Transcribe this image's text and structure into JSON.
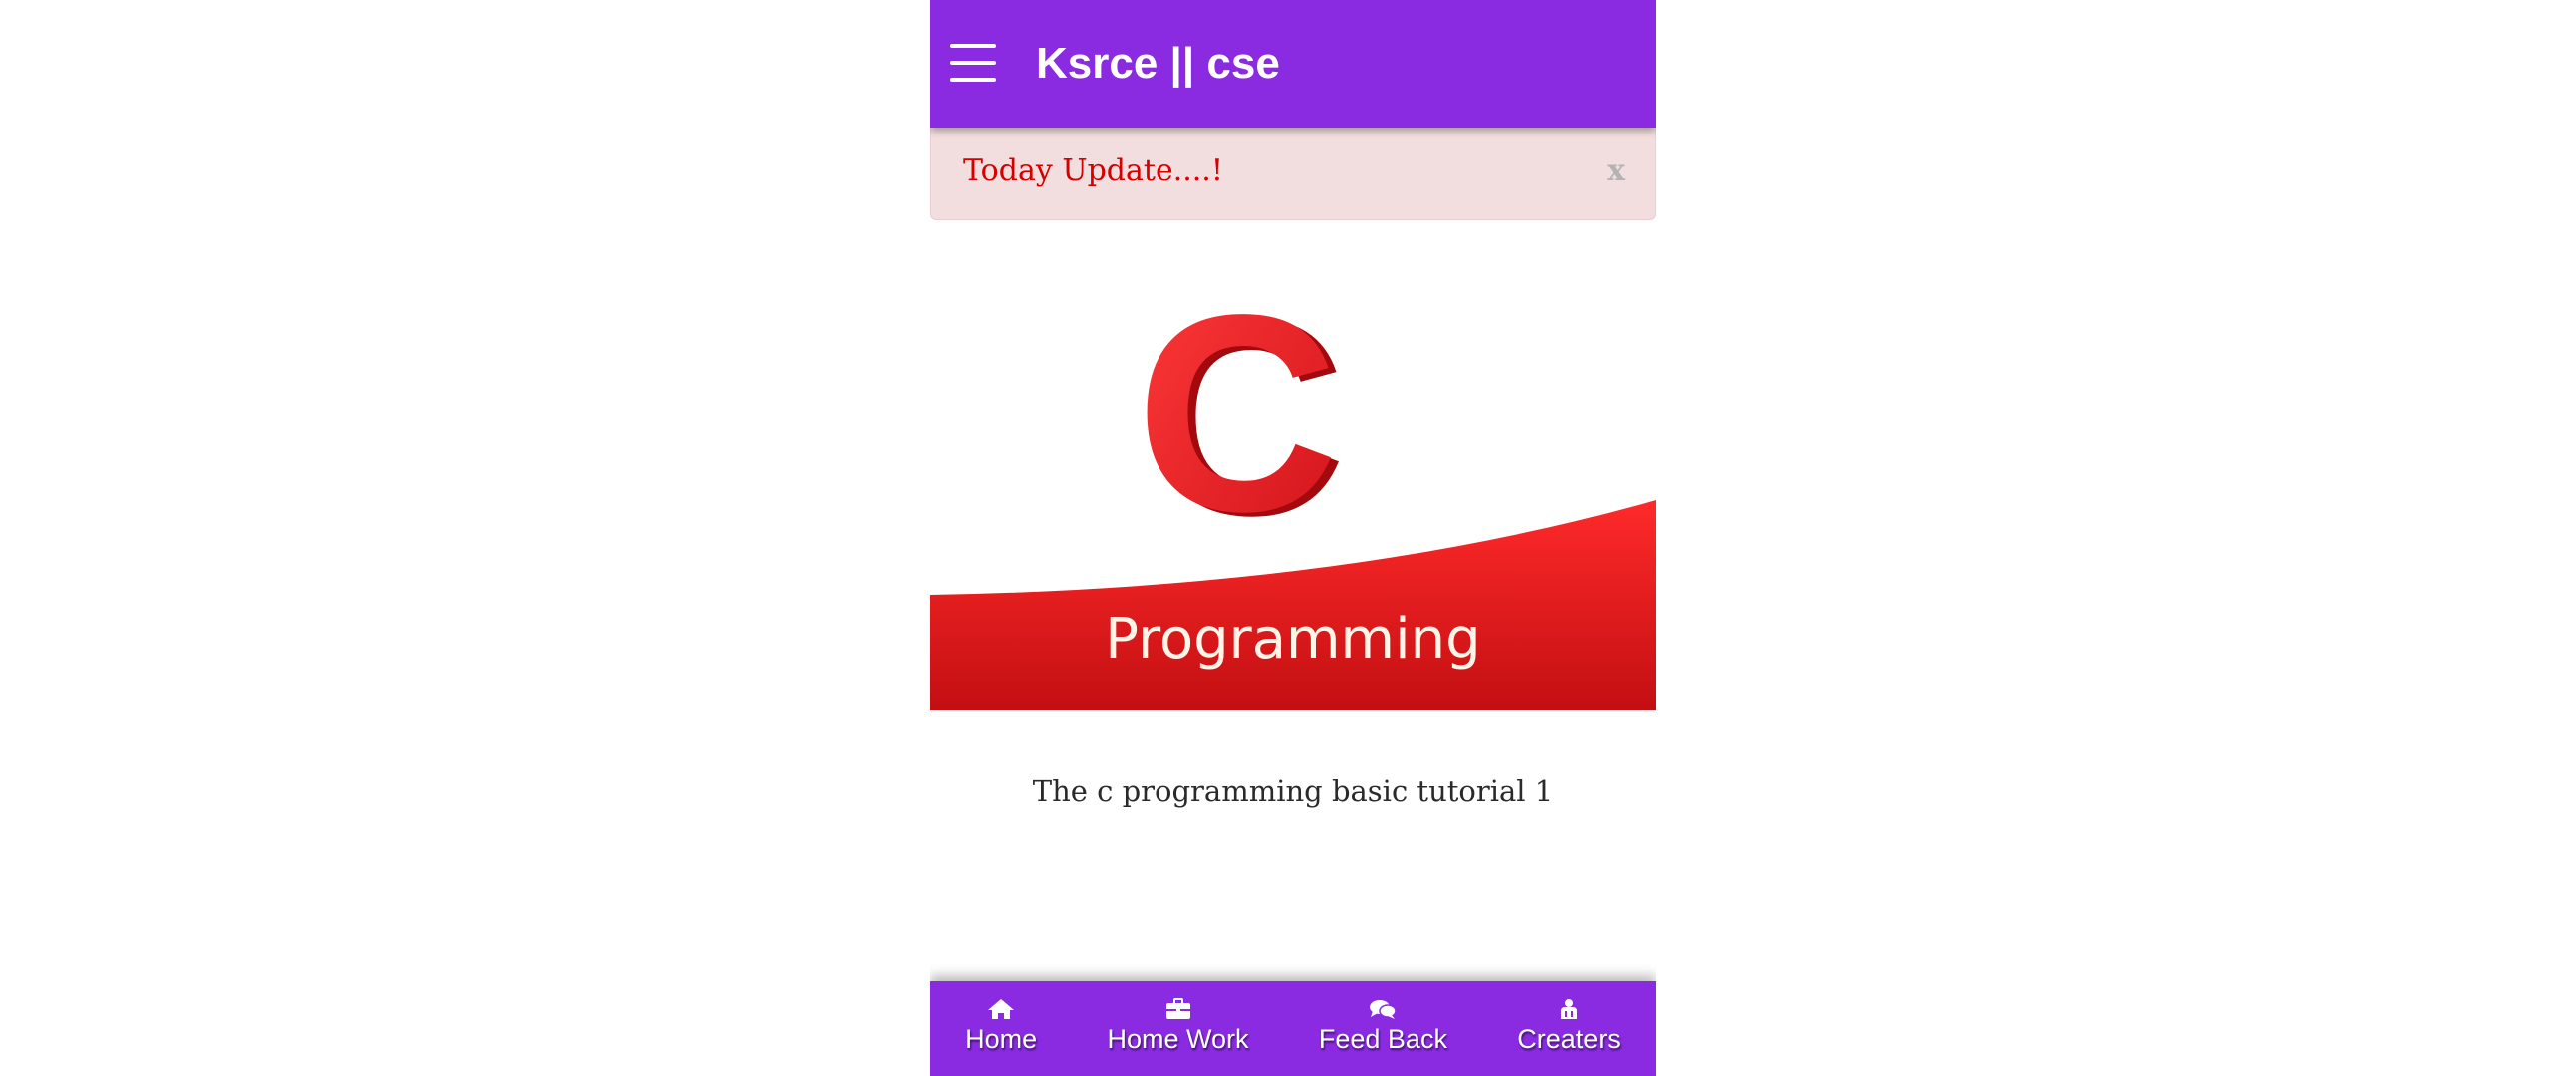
{
  "colors": {
    "primary": "#8a2be2",
    "alert_background": "#f2dede",
    "alert_text": "#d60000",
    "logo_red": "#e3161c"
  },
  "header": {
    "menu_icon": "hamburger-menu-icon",
    "title": "Ksrce || cse"
  },
  "alert": {
    "text": "Today Update....!",
    "close_label": "x"
  },
  "course": {
    "image_letter": "C",
    "image_word": "Programming",
    "caption": "The c programming basic tutorial 1"
  },
  "bottom_nav": {
    "items": [
      {
        "label": "Home",
        "icon": "home-icon"
      },
      {
        "label": "Home Work",
        "icon": "briefcase-icon"
      },
      {
        "label": "Feed Back",
        "icon": "comments-icon"
      },
      {
        "label": "Creaters",
        "icon": "users-icon"
      }
    ]
  }
}
